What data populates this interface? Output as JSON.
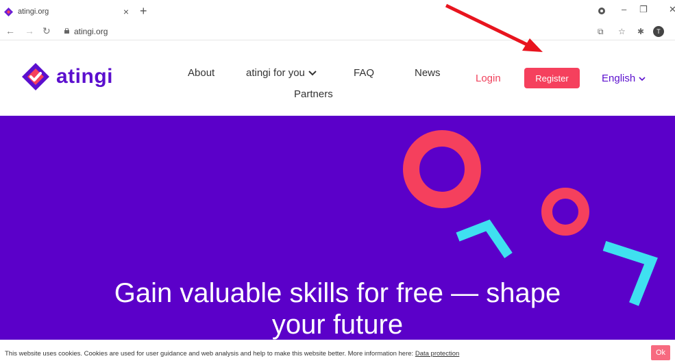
{
  "browser": {
    "tab_title": "atingi.org",
    "tab_close": "×",
    "new_tab": "+",
    "url": "atingi.org",
    "profile_initial": "T",
    "icons": [
      "back-icon",
      "forward-icon",
      "reload-icon",
      "lock-icon",
      "translate-icon",
      "star-icon",
      "extensions-icon"
    ]
  },
  "header": {
    "logo_text": "atingi",
    "nav": {
      "about": "About",
      "for_you": "atingi for you",
      "faq": "FAQ",
      "news": "News",
      "partners": "Partners"
    },
    "login": "Login",
    "register": "Register",
    "language": "English"
  },
  "hero": {
    "title_line1": "Gain valuable skills for free — shape",
    "title_line2": "your future"
  },
  "cookie_banner": {
    "text": "This website uses cookies. Cookies are used for user guidance and web analysis and help to make this website better. More information here: ",
    "link": "Data protection",
    "ok": "Ok"
  },
  "colors": {
    "brand_purple": "#5b00c9",
    "accent_red": "#f5405d",
    "cyan": "#3fe0f0",
    "arrow_red": "#e8141e"
  }
}
